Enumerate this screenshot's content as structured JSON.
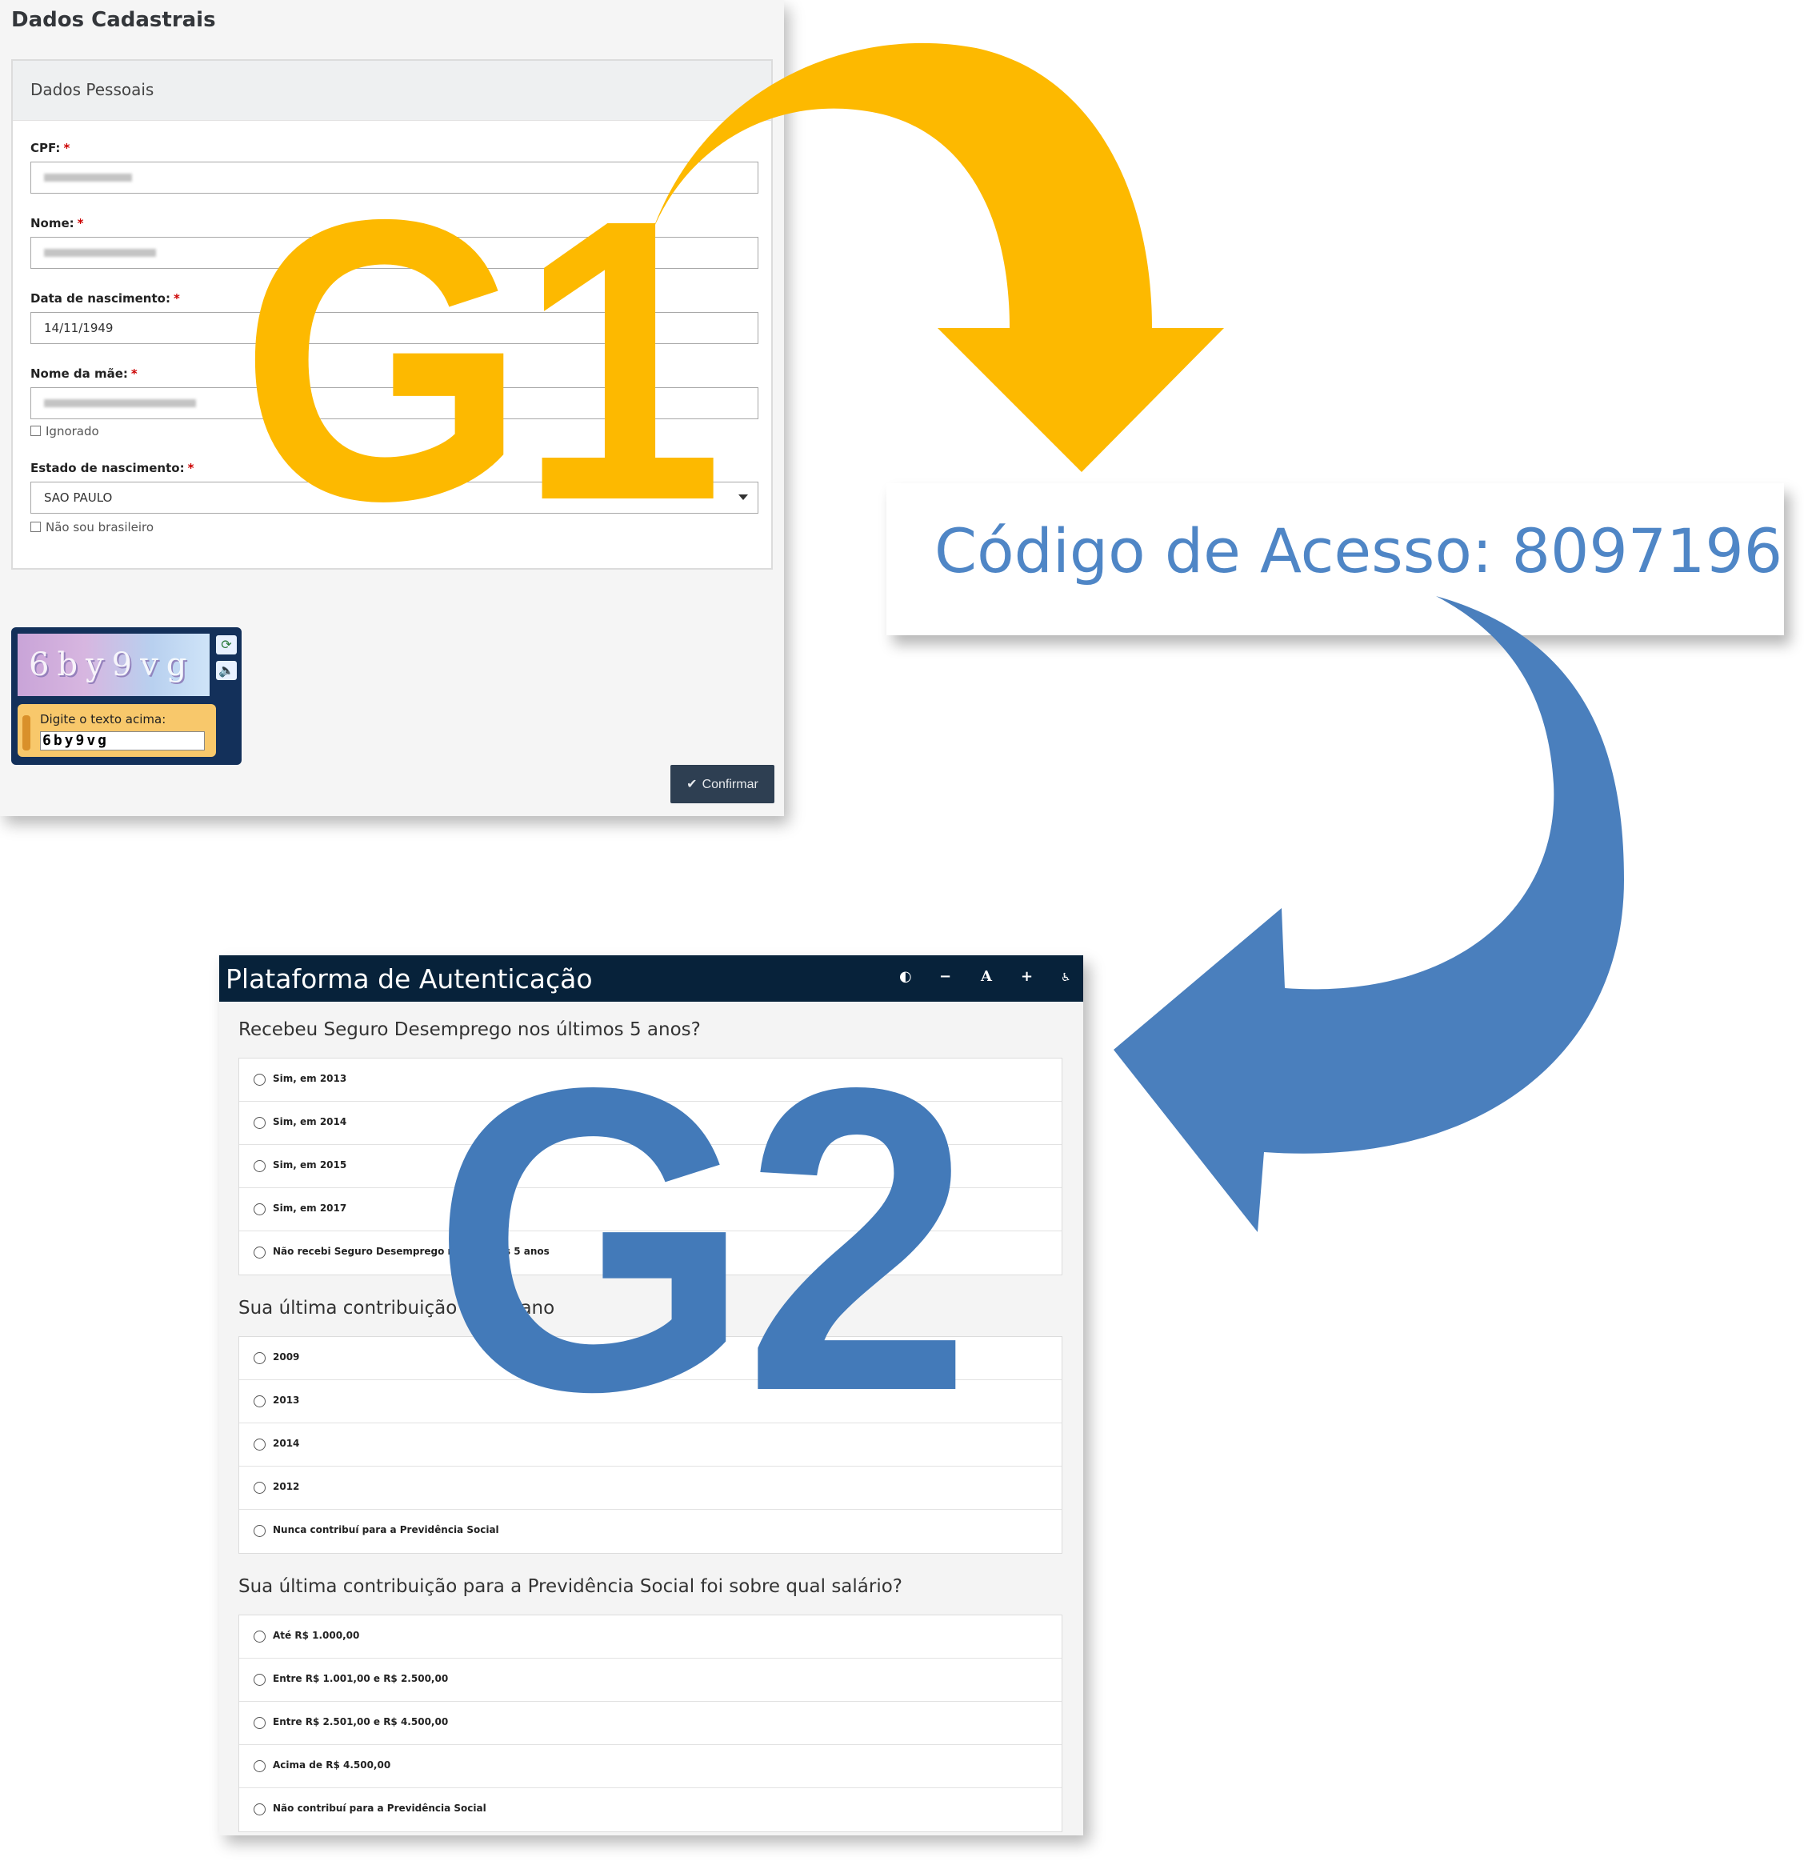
{
  "panel1": {
    "title": "Dados Cadastrais",
    "section": "Dados Pessoais",
    "fields": {
      "cpf_label": "CPF:",
      "nome_label": "Nome:",
      "nascimento_label": "Data de nascimento:",
      "nascimento_value": "14/11/1949",
      "mae_label": "Nome da mãe:",
      "ignorado_label": "Ignorado",
      "estado_label": "Estado de nascimento:",
      "estado_value": "SAO PAULO",
      "nao_brasileiro_label": "Não sou brasileiro",
      "required_mark": "*"
    },
    "captcha": {
      "image_text": "6by9vg",
      "hint": "Digite o texto acima:",
      "input_value": "6by9vg"
    },
    "confirm_label": "Confirmar"
  },
  "panel2": {
    "code_text": "Código de Acesso: 8097196"
  },
  "panel3": {
    "title": "Plataforma de Autenticação",
    "toolbar": {
      "contrast": "◐",
      "minus": "−",
      "font": "A",
      "plus": "+",
      "access": "♿"
    },
    "questions": [
      {
        "text": "Recebeu Seguro Desemprego nos últimos 5 anos?",
        "options": [
          "Sim, em 2013",
          "Sim, em 2014",
          "Sim, em 2015",
          "Sim, em 2017",
          "Não recebi Seguro Desemprego nos últimos 5 anos"
        ]
      },
      {
        "text": "Sua última contribuição foi no ano",
        "options": [
          "2009",
          "2013",
          "2014",
          "2012",
          "Nunca contribuí para a Previdência Social"
        ]
      },
      {
        "text": "Sua última contribuição para a Previdência Social foi sobre qual salário?",
        "options": [
          "Até R$ 1.000,00",
          "Entre R$ 1.001,00 e R$ 2.500,00",
          "Entre R$ 2.501,00 e R$ 4.500,00",
          "Acima de R$ 4.500,00",
          "Não contribuí para a Previdência Social"
        ]
      }
    ]
  },
  "overlay": {
    "g1_label": "G1",
    "g2_label": "G2",
    "colors": {
      "yellow": "#fdb900",
      "blue": "#437ab9"
    }
  }
}
